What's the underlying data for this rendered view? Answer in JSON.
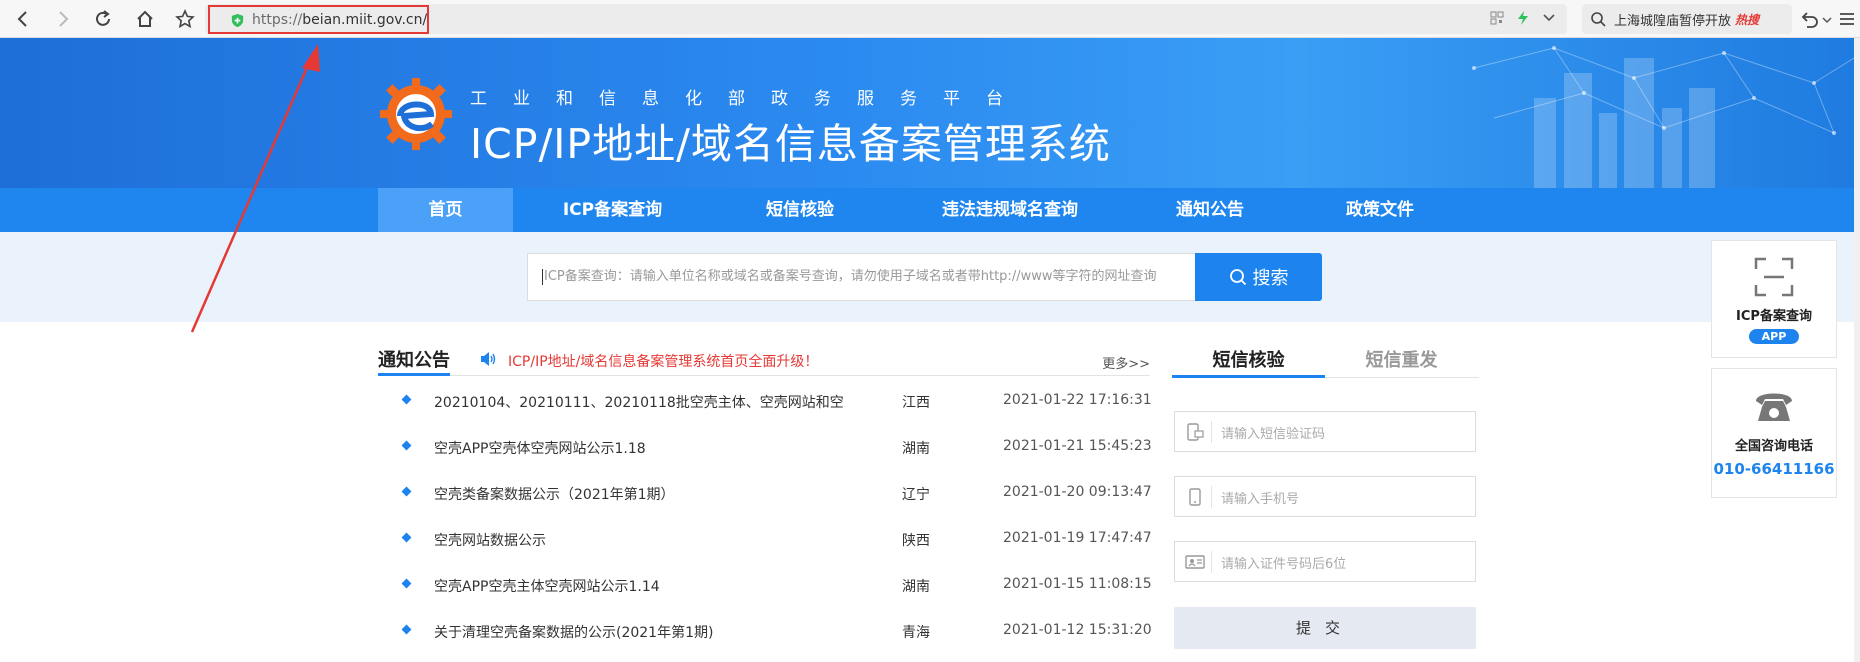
{
  "browser": {
    "url_protocol": "https://",
    "url_host": "beian.miit.gov.cn/",
    "search_text": "上海城隍庙暂停开放",
    "search_badge": "热搜"
  },
  "banner": {
    "subtitle": "工业和信息化部政务服务平台",
    "title": "ICP/IP地址/域名信息备案管理系统"
  },
  "nav": {
    "items": [
      {
        "label": "首页"
      },
      {
        "label": "ICP备案查询"
      },
      {
        "label": "短信核验"
      },
      {
        "label": "违法违规域名查询"
      },
      {
        "label": "通知公告"
      },
      {
        "label": "政策文件"
      }
    ]
  },
  "search": {
    "placeholder": "ICP备案查询：请输入单位名称或域名或备案号查询，请勿使用子域名或者带http://www等字符的网址查询",
    "button_label": "搜索"
  },
  "notices": {
    "tab_label": "通知公告",
    "marquee": "ICP/IP地址/域名信息备案管理系统首页全面升级！",
    "more_label": "更多>>",
    "rows": [
      {
        "title": "20210104、20210111、20210118批空壳主体、空壳网站和空",
        "region": "江西",
        "date": "2021-01-22 17:16:31"
      },
      {
        "title": "空壳APP空壳体空壳网站公示1.18",
        "region": "湖南",
        "date": "2021-01-21 15:45:23"
      },
      {
        "title": "空壳类备案数据公示（2021年第1期）",
        "region": "辽宁",
        "date": "2021-01-20 09:13:47"
      },
      {
        "title": "空壳网站数据公示",
        "region": "陕西",
        "date": "2021-01-19 17:47:47"
      },
      {
        "title": "空壳APP空壳主体空壳网站公示1.14",
        "region": "湖南",
        "date": "2021-01-15 11:08:15"
      },
      {
        "title": "关于清理空壳备案数据的公示(2021年第1期)",
        "region": "青海",
        "date": "2021-01-12 15:31:20"
      }
    ]
  },
  "sms": {
    "tab_verify": "短信核验",
    "tab_resend": "短信重发",
    "code_placeholder": "请输入短信验证码",
    "phone_placeholder": "请输入手机号",
    "id_placeholder": "请输入证件号码后6位",
    "submit_label": "提交"
  },
  "side": {
    "app_title": "ICP备案查询",
    "app_badge": "APP",
    "phone_title": "全国咨询电话",
    "phone_number": "010-66411166"
  },
  "colors": {
    "brand_blue": "#1d84ef",
    "nav_blue": "#1f86f0",
    "highlight_red": "#e53935"
  }
}
